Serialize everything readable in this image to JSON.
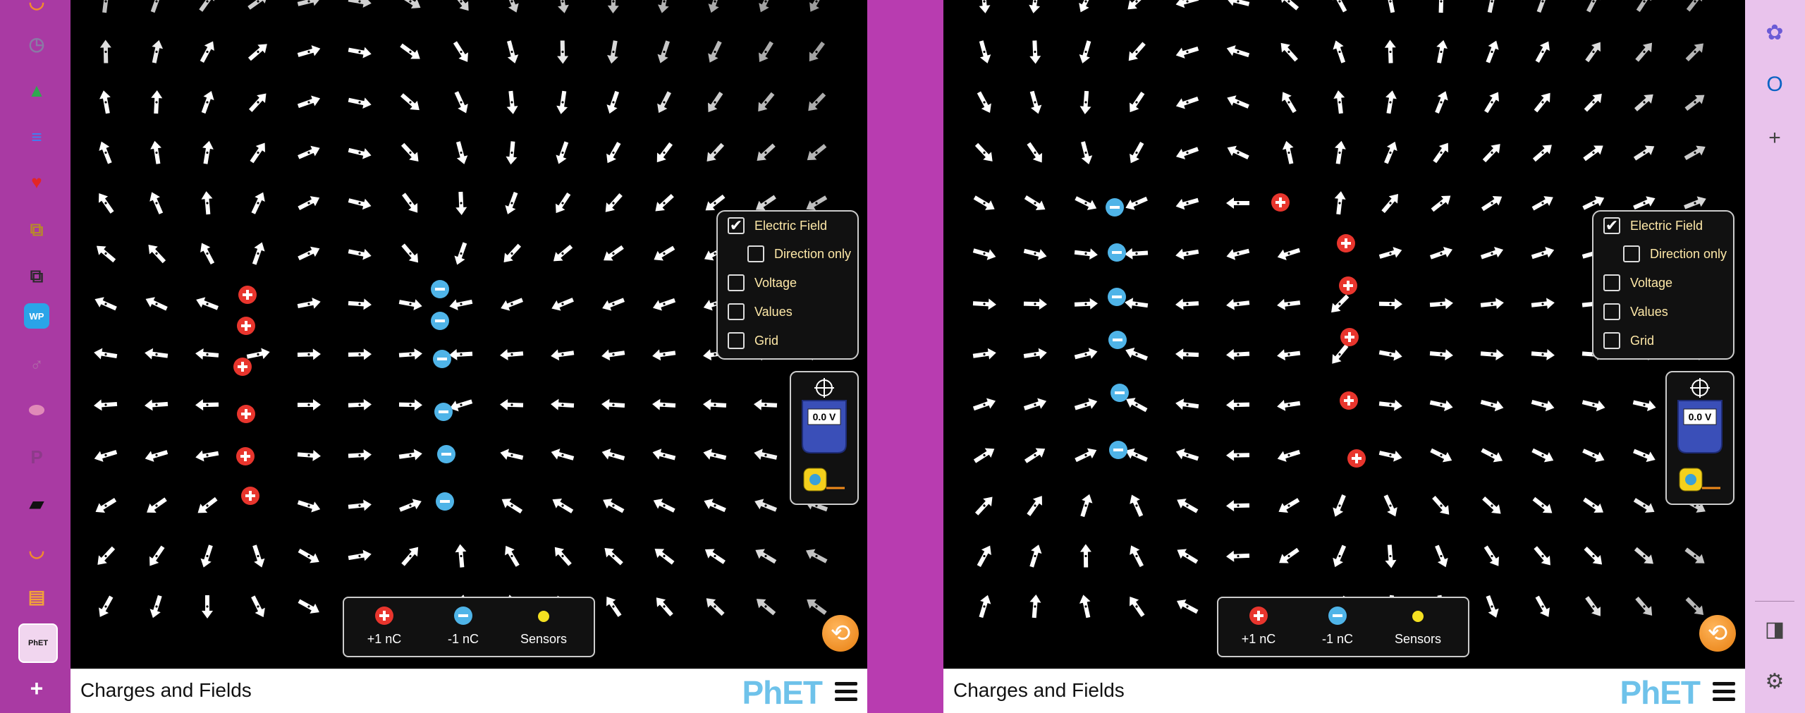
{
  "left_rail": {
    "icons": [
      {
        "name": "half-circle-app-icon",
        "glyph": "◡",
        "color": "#f28b2c"
      },
      {
        "name": "clock-app-icon",
        "glyph": "◷",
        "color": "#8a7aa5"
      },
      {
        "name": "google-drive-icon",
        "glyph": "▲",
        "color": "#2fa84f"
      },
      {
        "name": "google-docs-icon",
        "glyph": "≡",
        "color": "#3b82f6"
      },
      {
        "name": "heart-icon",
        "glyph": "♥",
        "color": "#e32626"
      },
      {
        "name": "copy-app-icon",
        "glyph": "⧉",
        "color": "#b88a2a"
      },
      {
        "name": "copy-app-icon-2",
        "glyph": "⧉",
        "color": "#2a2a2a"
      },
      {
        "name": "wordpress-icon",
        "glyph": "WP",
        "color": "#2aa4e8"
      },
      {
        "name": "female-symbol-icon",
        "glyph": "♂",
        "color": "#b06aa8"
      },
      {
        "name": "egg-icon",
        "glyph": "⬬",
        "color": "#e08ab8"
      },
      {
        "name": "p-letter-icon",
        "glyph": "P",
        "color": "#8d3a8a"
      },
      {
        "name": "book-icon",
        "glyph": "▰",
        "color": "#111"
      },
      {
        "name": "half-circle-app-icon-2",
        "glyph": "◡",
        "color": "#f28b2c"
      },
      {
        "name": "notebook-icon",
        "glyph": "▤",
        "color": "#f2a23a"
      },
      {
        "name": "phet-app-icon",
        "glyph": "PhET",
        "color": "#111"
      }
    ],
    "add_label": "+"
  },
  "sims": [
    {
      "footer_title": "Charges and Fields",
      "logo_text": "PhET",
      "controls": {
        "electric_field": "Electric Field",
        "direction_only": "Direction only",
        "voltage": "Voltage",
        "values": "Values",
        "grid": "Grid"
      },
      "checkbox_states": {
        "electric_field": true,
        "direction_only": false,
        "voltage": false,
        "values": false,
        "grid": false
      },
      "voltmeter_reading": "0.0 V",
      "tray": {
        "plus": "+1 nC",
        "minus": "-1 nC",
        "sensors": "Sensors"
      }
    },
    {
      "footer_title": "Charges and Fields",
      "logo_text": "PhET",
      "controls": {
        "electric_field": "Electric Field",
        "direction_only": "Direction only",
        "voltage": "Voltage",
        "values": "Values",
        "grid": "Grid"
      },
      "checkbox_states": {
        "electric_field": true,
        "direction_only": false,
        "voltage": false,
        "values": false,
        "grid": false
      },
      "voltmeter_reading": "0.0 V",
      "tray": {
        "plus": "+1 nC",
        "minus": "-1 nC",
        "sensors": "Sensors"
      }
    }
  ],
  "right_rail": {
    "icons": [
      {
        "name": "copilot-icon",
        "glyph": "✿",
        "color": "#6b5bd6"
      },
      {
        "name": "outlook-icon",
        "glyph": "O",
        "color": "#0b63c4"
      },
      {
        "name": "add-icon",
        "glyph": "+",
        "color": "#444"
      },
      {
        "name": "sidebar-toggle-icon",
        "glyph": "◨",
        "color": "#444"
      },
      {
        "name": "settings-gear-icon",
        "glyph": "⚙",
        "color": "#444"
      }
    ]
  },
  "colors": {
    "positive": "#e8352d",
    "negative": "#4fb4e8",
    "accent": "#b83cb0"
  }
}
